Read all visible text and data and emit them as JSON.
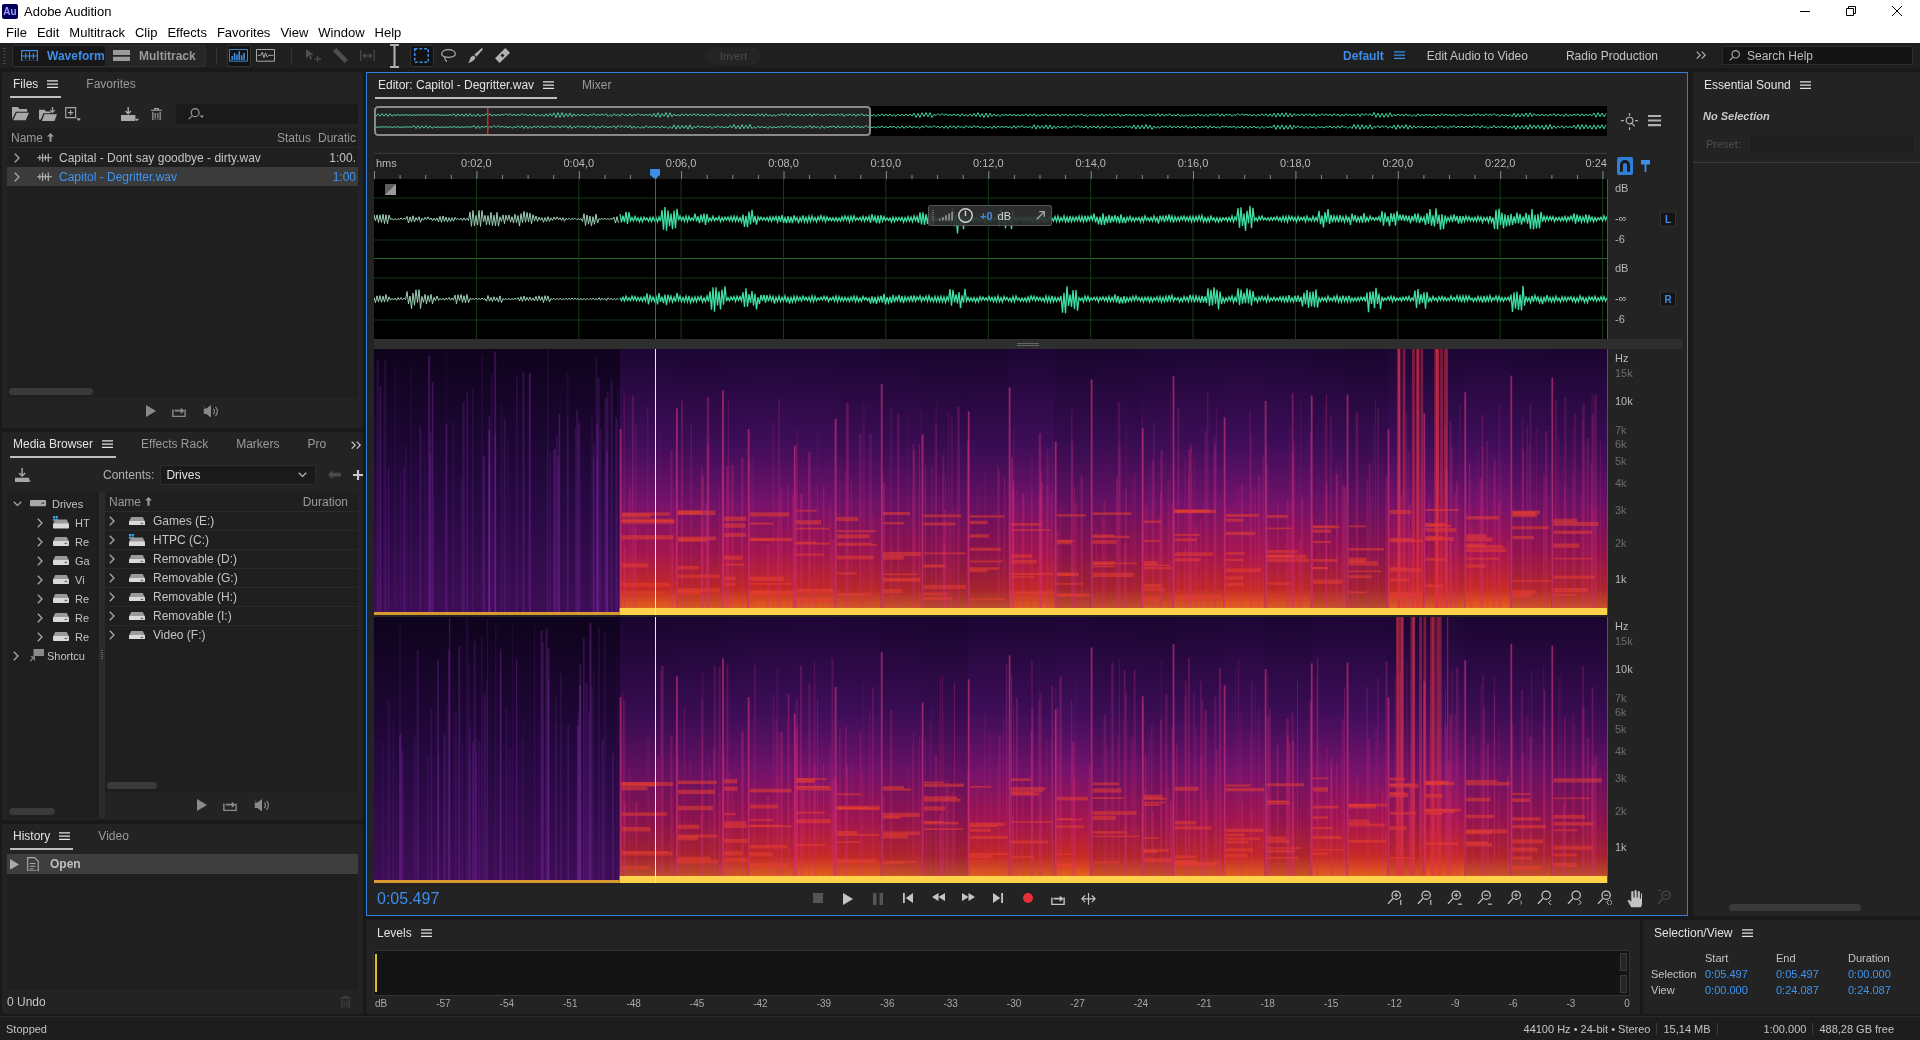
{
  "window": {
    "logo": "Au",
    "title": "Adobe Audition"
  },
  "menu": [
    "File",
    "Edit",
    "Multitrack",
    "Clip",
    "Effects",
    "Favorites",
    "View",
    "Window",
    "Help"
  ],
  "toolbar": {
    "modes": [
      {
        "label": "Waveform",
        "selected": true
      },
      {
        "label": "Multitrack",
        "selected": false
      }
    ],
    "displays": [
      {
        "selected": true
      },
      {
        "selected": false
      }
    ],
    "tools": [
      {
        "selected": false,
        "disabled": true
      },
      {
        "selected": false,
        "disabled": true
      },
      {
        "selected": false,
        "disabled": true
      },
      {
        "selected": false,
        "disabled": false
      },
      {
        "selected": true,
        "disabled": false
      },
      {
        "selected": false,
        "disabled": false
      },
      {
        "selected": false,
        "disabled": false
      },
      {
        "selected": false,
        "disabled": false
      }
    ],
    "invert": {
      "label": "Invert",
      "disabled": true
    },
    "workspaces": [
      {
        "label": "Default",
        "selected": true
      },
      {
        "label": "Edit Audio to Video",
        "selected": false
      },
      {
        "label": "Radio Production",
        "selected": false
      }
    ],
    "search": {
      "placeholder": "Search Help"
    }
  },
  "files_panel": {
    "tabs": [
      {
        "label": "Files",
        "selected": true
      },
      {
        "label": "Favorites",
        "selected": false
      }
    ],
    "columns": [
      "Name",
      "Status",
      "Duratic"
    ],
    "rows": [
      {
        "name": "Capital - Dont say goodbye - dirty.wav",
        "duration": "1:00.",
        "selected": false,
        "expanded": false
      },
      {
        "name": "Capitol - Degritter.wav",
        "duration": "1:00",
        "selected": true,
        "expanded": false
      }
    ]
  },
  "media_browser": {
    "tabs": [
      {
        "label": "Media Browser",
        "selected": true
      },
      {
        "label": "Effects Rack",
        "selected": false
      },
      {
        "label": "Markers",
        "selected": false
      },
      {
        "label": "Pro",
        "selected": false
      }
    ],
    "contents_label": "Contents:",
    "contents": "Drives",
    "tree": [
      {
        "label": "Drives",
        "kind": "group",
        "expanded": true,
        "children": [
          {
            "label": "HT",
            "kind": "system",
            "expanded": false
          },
          {
            "label": "Re",
            "kind": "drive",
            "expanded": false
          },
          {
            "label": "Ga",
            "kind": "drive",
            "expanded": false
          },
          {
            "label": "Vi",
            "kind": "drive",
            "expanded": false
          },
          {
            "label": "Re",
            "kind": "drive",
            "expanded": false
          },
          {
            "label": "Re",
            "kind": "drive",
            "expanded": false
          },
          {
            "label": "Re",
            "kind": "drive",
            "expanded": false
          }
        ]
      },
      {
        "label": "Shortcu",
        "kind": "shortcut",
        "expanded": false
      }
    ],
    "columns": [
      "Name",
      "Duration"
    ],
    "rows": [
      {
        "name": "Games (E:)",
        "kind": "drive",
        "expanded": false
      },
      {
        "name": "HTPC (C:)",
        "kind": "system",
        "expanded": false
      },
      {
        "name": "Removable (D:)",
        "kind": "drive",
        "expanded": false
      },
      {
        "name": "Removable (G:)",
        "kind": "drive",
        "expanded": false
      },
      {
        "name": "Removable (H:)",
        "kind": "drive",
        "expanded": false
      },
      {
        "name": "Removable (I:)",
        "kind": "drive",
        "expanded": false
      },
      {
        "name": "Video (F:)",
        "kind": "drive",
        "expanded": false
      }
    ]
  },
  "history": {
    "tabs": [
      {
        "label": "History",
        "selected": true
      },
      {
        "label": "Video",
        "selected": false
      }
    ],
    "items": [
      {
        "label": "Open",
        "selected": true
      }
    ],
    "undo": "0 Undo"
  },
  "editor": {
    "tabs": [
      {
        "label": "Editor: Capitol - Degritter.wav",
        "selected": true
      },
      {
        "label": "Mixer",
        "selected": false
      }
    ],
    "ruler": {
      "unit": "hms",
      "labels": [
        "0:02,0",
        "0:04,0",
        "0:06,0",
        "0:08,0",
        "0:10,0",
        "0:12,0",
        "0:14,0",
        "0:16,0",
        "0:18,0",
        "0:20,0",
        "0:22,0",
        "0:24"
      ]
    },
    "snap": {
      "on": true
    },
    "playhead": {
      "level": 0.228
    },
    "channels": [
      {
        "badge": "L",
        "scale": [
          "dB",
          "-∞",
          "-6"
        ]
      },
      {
        "badge": "R",
        "scale": [
          "dB",
          "-∞",
          "-6"
        ]
      }
    ],
    "hud": {
      "value": "+0",
      "unit": "dB"
    },
    "spectral_channels": [
      {
        "scale": [
          {
            "label": "Hz",
            "major": true
          },
          {
            "label": "15k",
            "major": false
          },
          {
            "label": "10k",
            "major": true
          },
          {
            "label": "7k",
            "major": false
          },
          {
            "label": "6k",
            "major": false
          },
          {
            "label": "5k",
            "major": false
          },
          {
            "label": "4k",
            "major": false
          },
          {
            "label": "3k",
            "major": false
          },
          {
            "label": "2k",
            "major": false
          },
          {
            "label": "1k",
            "major": true
          }
        ]
      },
      {
        "scale": [
          {
            "label": "Hz",
            "major": true
          },
          {
            "label": "15k",
            "major": false
          },
          {
            "label": "10k",
            "major": true
          },
          {
            "label": "7k",
            "major": false
          },
          {
            "label": "6k",
            "major": false
          },
          {
            "label": "5k",
            "major": false
          },
          {
            "label": "4k",
            "major": false
          },
          {
            "label": "3k",
            "major": false
          },
          {
            "label": "2k",
            "major": false
          },
          {
            "label": "1k",
            "major": true
          }
        ]
      }
    ],
    "time": "0:05.497",
    "transport": [
      {
        "disabled": true
      },
      {
        "disabled": false
      },
      {
        "disabled": true
      },
      {
        "disabled": false
      },
      {
        "disabled": false
      },
      {
        "disabled": false
      },
      {
        "disabled": false
      },
      {
        "disabled": false
      },
      {
        "disabled": false
      },
      {
        "disabled": false
      }
    ],
    "zoom_tools": [
      {
        "disabled": false
      },
      {
        "disabled": false
      },
      {
        "disabled": false
      },
      {
        "disabled": false
      },
      {
        "disabled": false
      },
      {
        "disabled": false
      },
      {
        "disabled": false
      },
      {
        "disabled": false
      },
      {
        "disabled": false
      },
      {
        "disabled": true
      }
    ]
  },
  "essential_sound": {
    "title": "Essential Sound",
    "status": "No Selection",
    "preset": {
      "label": "Preset:",
      "disabled": true
    }
  },
  "levels": {
    "title": "Levels",
    "scale": [
      "dB",
      "-57",
      "-54",
      "-51",
      "-48",
      "-45",
      "-42",
      "-39",
      "-36",
      "-33",
      "-30",
      "-27",
      "-24",
      "-21",
      "-18",
      "-15",
      "-12",
      "-9",
      "-6",
      "-3",
      "0"
    ]
  },
  "selection_view": {
    "title": "Selection/View",
    "columns": [
      "Start",
      "End",
      "Duration"
    ],
    "rows": [
      {
        "label": "Selection",
        "values": [
          "0:05.497",
          "0:05.497",
          "0:00.000"
        ]
      },
      {
        "label": "View",
        "values": [
          "0:00.000",
          "0:24.087",
          "0:24.087"
        ]
      }
    ]
  },
  "status_bar": {
    "state": "Stopped",
    "items": [
      "44100 Hz • 24-bit • Stereo",
      "15,14 MB",
      "1:00.000",
      "488,28 GB free"
    ]
  }
}
